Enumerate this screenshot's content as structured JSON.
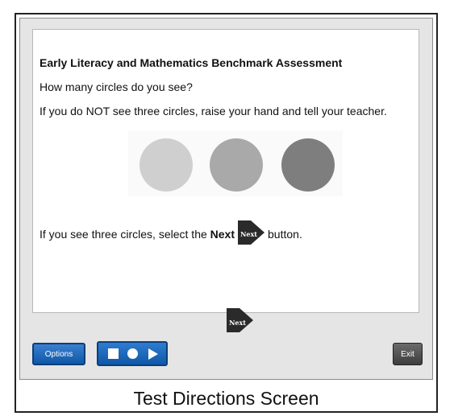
{
  "assessment": {
    "title": "Early Literacy and Mathematics Benchmark Assessment",
    "question": "How many circles do you see?",
    "instruction_not_three": "If you do NOT see three circles, raise your hand and tell your teacher.",
    "instruction_prefix": "If you see three circles, select the",
    "instruction_bold": "Next",
    "instruction_suffix": "button.",
    "circles": [
      {
        "color": "#cfcfcf"
      },
      {
        "color": "#a9a9a9"
      },
      {
        "color": "#7e7e7e"
      }
    ]
  },
  "navigation": {
    "next_label": "Next",
    "next_icon": "next-arrow-icon"
  },
  "toolbar": {
    "options_label": "Options",
    "exit_label": "Exit",
    "media_icons": [
      "stop-icon",
      "record-icon",
      "play-icon"
    ],
    "colors": {
      "blue": "#1461b5",
      "exit": "#4a4a4a"
    }
  },
  "caption": "Test Directions Screen"
}
